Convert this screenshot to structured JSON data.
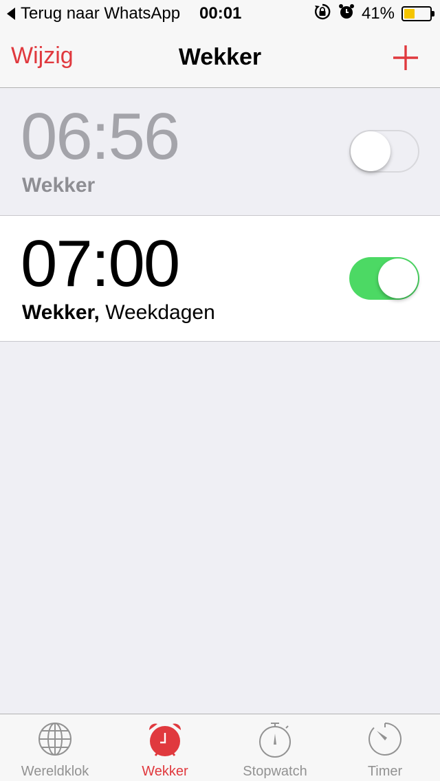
{
  "status_bar": {
    "back_label": "Terug naar WhatsApp",
    "time": "00:01",
    "battery_percent": "41%",
    "battery_level": 0.41,
    "icons": [
      "back-arrow-icon",
      "rotation-lock-icon",
      "alarm-clock-icon",
      "battery-icon"
    ]
  },
  "nav": {
    "edit_label": "Wijzig",
    "title": "Wekker",
    "add_icon": "plus-icon"
  },
  "alarms": [
    {
      "time": "06:56",
      "label": "Wekker",
      "enabled": false
    },
    {
      "time": "07:00",
      "label_bold": "Wekker,",
      "label_rest": " Weekdagen",
      "enabled": true
    }
  ],
  "tabs": [
    {
      "label": "Wereldklok",
      "icon": "globe-icon",
      "active": false
    },
    {
      "label": "Wekker",
      "icon": "alarm-clock-icon",
      "active": true
    },
    {
      "label": "Stopwatch",
      "icon": "stopwatch-icon",
      "active": false
    },
    {
      "label": "Timer",
      "icon": "timer-icon",
      "active": false
    }
  ],
  "colors": {
    "accent": "#e0393e",
    "toggle_on": "#4cd964",
    "battery": "#f5c500",
    "background": "#efeff4"
  }
}
